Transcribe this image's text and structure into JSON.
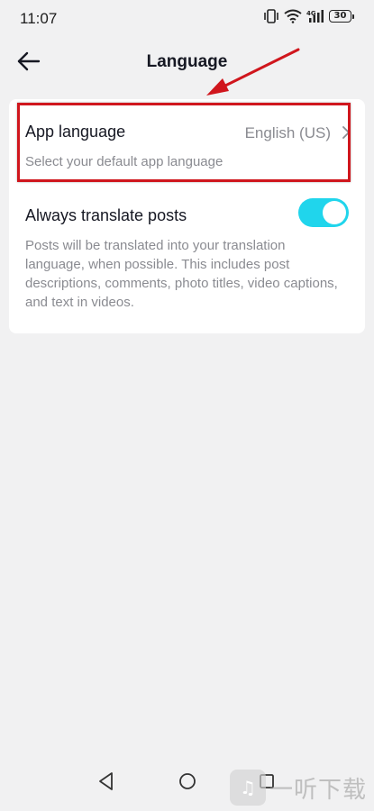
{
  "status_bar": {
    "time": "11:07",
    "battery": "30",
    "icons": [
      "vibrate-icon",
      "wifi-icon",
      "signal-4g-icon",
      "battery-icon"
    ]
  },
  "header": {
    "title": "Language",
    "back_icon": "arrow-left-icon"
  },
  "app_language": {
    "title": "App language",
    "value": "English (US)",
    "subtitle": "Select your default app language",
    "chevron_icon": "chevron-right-icon"
  },
  "translate": {
    "title": "Always translate posts",
    "enabled": true,
    "description": "Posts will be translated into your translation language, when possible. This includes post descriptions, comments, photo titles, video captions, and text in videos."
  },
  "annotation": {
    "color": "#d0161d"
  },
  "colors": {
    "accent": "#20d5ec",
    "text_primary": "#161823",
    "text_secondary": "#8a8b91",
    "background": "#f1f1f2"
  },
  "nav_bar": {
    "icons": [
      "nav-back-icon",
      "nav-home-icon",
      "nav-recents-icon"
    ]
  },
  "watermark": {
    "text": "一听下载"
  }
}
